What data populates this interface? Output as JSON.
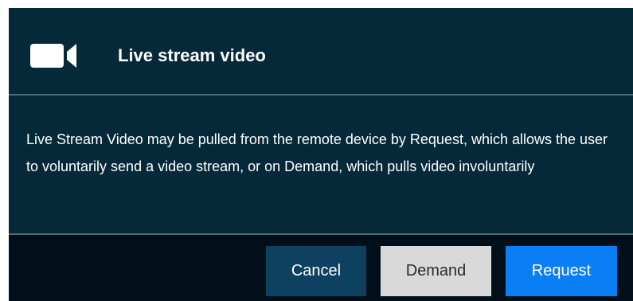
{
  "dialog": {
    "icon": "video-camera-icon",
    "title": "Live stream video",
    "body": "Live Stream Video may be pulled from the remote device by Request, which allows the user to voluntarily send a video stream, or on Demand, which pulls video involuntarily",
    "buttons": {
      "cancel": "Cancel",
      "demand": "Demand",
      "request": "Request"
    }
  },
  "colors": {
    "dialog_background": "#06293a",
    "footer_background": "#010f1b",
    "divider": "#4c6977",
    "cancel_button": "#0e4160",
    "demand_button": "#d9d9d9",
    "request_button": "#0a7ff5"
  }
}
